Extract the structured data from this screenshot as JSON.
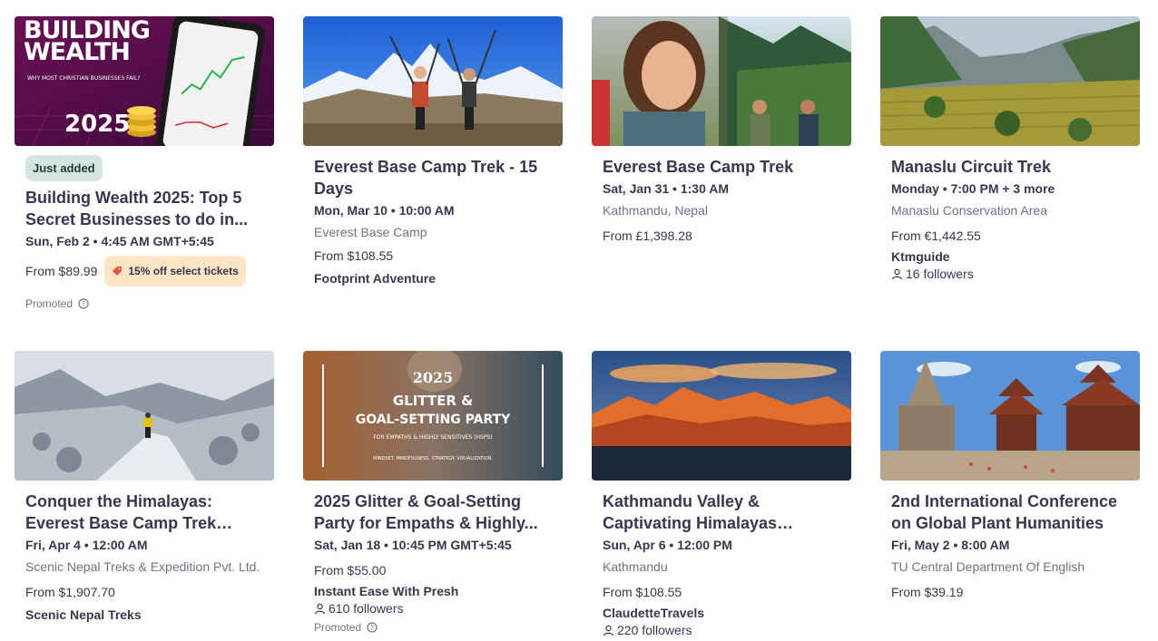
{
  "cards": [
    {
      "image_text": {
        "line1": "BUILDING",
        "line2": "WEALTH",
        "sub": "WHY MOST CHRISTIAN BUSINESSES FAIL?",
        "year": "2025"
      },
      "badge": "Just added",
      "title": "Building Wealth 2025: Top 5 Secret Businesses to do in...",
      "date": "Sun, Feb 2 • 4:45 AM GMT+5:45",
      "price": "From $89.99",
      "promo": "15% off select tickets",
      "promoted": "Promoted",
      "icons": [
        "tag-icon",
        "info-icon"
      ]
    },
    {
      "title": "Everest Base Camp Trek - 15 Days",
      "date": "Mon, Mar 10 • 10:00 AM",
      "location": "Everest Base Camp",
      "price": "From $108.55",
      "organizer": "Footprint Adventure"
    },
    {
      "title": "Everest Base Camp Trek",
      "date": "Sat, Jan 31 • 1:30 AM",
      "location": "Kathmandu, Nepal",
      "price": "From £1,398.28"
    },
    {
      "title": "Manaslu Circuit Trek",
      "date": "Monday • 7:00 PM + 3 more",
      "location": "Manaslu Conservation Area",
      "price": "From €1,442.55",
      "organizer": "Ktmguide",
      "followers": "16 followers"
    },
    {
      "title": "Conquer the Himalayas: Everest Base Camp Trek Adventure",
      "date": "Fri, Apr 4 • 12:00 AM",
      "location": "Scenic Nepal Treks & Expedition Pvt. Ltd.",
      "price": "From $1,907.70",
      "organizer": "Scenic Nepal Treks"
    },
    {
      "image_text": {
        "year": "2025",
        "line1": "GLITTER &",
        "line2": "GOAL-SETTING PARTY",
        "sub": "FOR EMPATHS & HIGHLY SENSITIVES (HSPS)",
        "foot": "MINDSET. MINDFULNESS. STRATEGY. VISUALIZATION."
      },
      "title": "2025 Glitter & Goal-Setting Party for Empaths & Highly...",
      "date": "Sat, Jan 18 • 10:45 PM GMT+5:45",
      "price": "From $55.00",
      "organizer": "Instant Ease With Presh",
      "followers": "610 followers",
      "promoted": "Promoted"
    },
    {
      "title": "Kathmandu Valley & Captivating Himalayas Vacati...",
      "date": "Sun, Apr 6 • 12:00 PM",
      "location": "Kathmandu",
      "price": "From $108.55",
      "organizer": "ClaudetteTravels",
      "followers": "220 followers"
    },
    {
      "title": "2nd International Conference on Global Plant Humanities",
      "date": "Fri, May 2 • 8:00 AM",
      "location": "TU Central Department Of English",
      "price": "From $39.19"
    }
  ]
}
